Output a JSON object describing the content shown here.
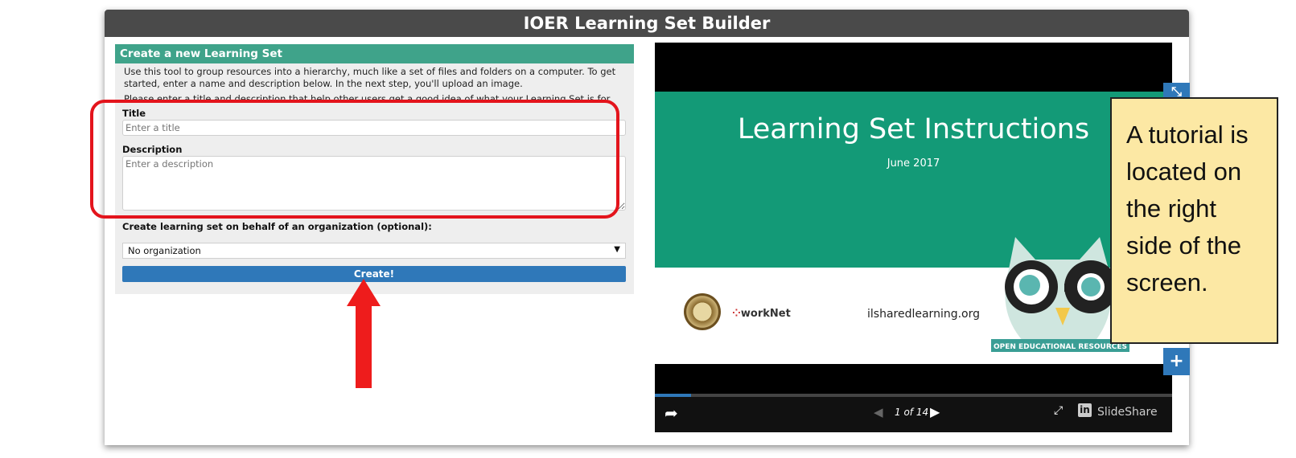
{
  "window": {
    "title": "IOER Learning Set Builder"
  },
  "form": {
    "heading": "Create a new Learning Set",
    "intro": "Use this tool to group resources into a hierarchy, much like a set of files and folders on a computer. To get started, enter a name and description below. In the next step, you'll upload an image.",
    "intro_cut": "Please enter a title and description that help other users get a good idea of what your Learning Set is for.",
    "title_label": "Title",
    "title_placeholder": "Enter a title",
    "description_label": "Description",
    "description_placeholder": "Enter a description",
    "org_label": "Create learning set on behalf of an organization (optional):",
    "org_selected": "No organization",
    "create_label": "Create!"
  },
  "viewer": {
    "slide_title": "Learning Set Instructions",
    "slide_date": "June 2017",
    "slide_url": "ilsharedlearning.org",
    "worknet_logo": "workNet",
    "oer_badge": "OPEN EDUCATIONAL RESOURCES",
    "page_indicator": "1 of 14",
    "brand": "SlideShare",
    "progress_fraction": 0.07
  },
  "callout": {
    "text": "A tutorial is located on the right side of the screen."
  },
  "colors": {
    "titlebar": "#4a4a4a",
    "panel_header": "#3fa38a",
    "button": "#2f78b9",
    "slide_green": "#139a77",
    "highlight": "#e3141c",
    "callout_bg": "#fce8a4"
  },
  "icons": [
    "share-icon",
    "prev-icon",
    "next-icon",
    "fullscreen-icon",
    "linkedin-icon",
    "plus-icon",
    "up-arrow-icon"
  ]
}
